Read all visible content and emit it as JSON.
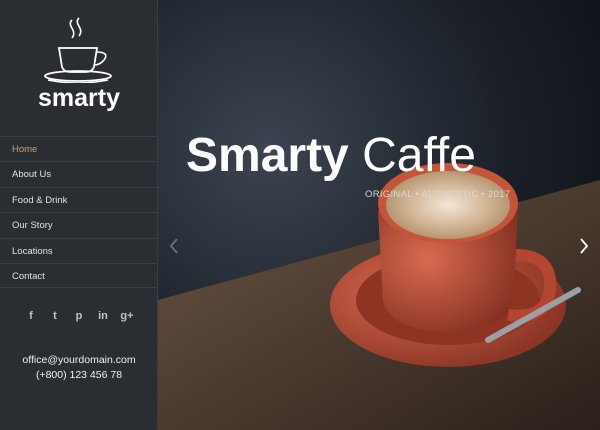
{
  "logo": {
    "text": "smarty"
  },
  "nav": {
    "items": [
      {
        "label": "Home",
        "active": true
      },
      {
        "label": "About Us"
      },
      {
        "label": "Food & Drink"
      },
      {
        "label": "Our Story"
      },
      {
        "label": "Locations"
      },
      {
        "label": "Contact"
      }
    ]
  },
  "social": {
    "icons": [
      "facebook-icon",
      "twitter-icon",
      "pinterest-icon",
      "linkedin-icon",
      "google-plus-icon"
    ],
    "glyphs": [
      "f",
      "t",
      "p",
      "in",
      "g+"
    ]
  },
  "contact": {
    "email": "office@yourdomain.com",
    "phone": "(+800) 123 456 78"
  },
  "hero": {
    "title_bold": "Smarty",
    "title_light": "Caffe",
    "subtitle": "ORIGINAL • AUTHENTIC • 2017"
  },
  "colors": {
    "sidebar_bg": "#2a2d32",
    "accent": "#c8a070",
    "cup": "#b94a33"
  }
}
